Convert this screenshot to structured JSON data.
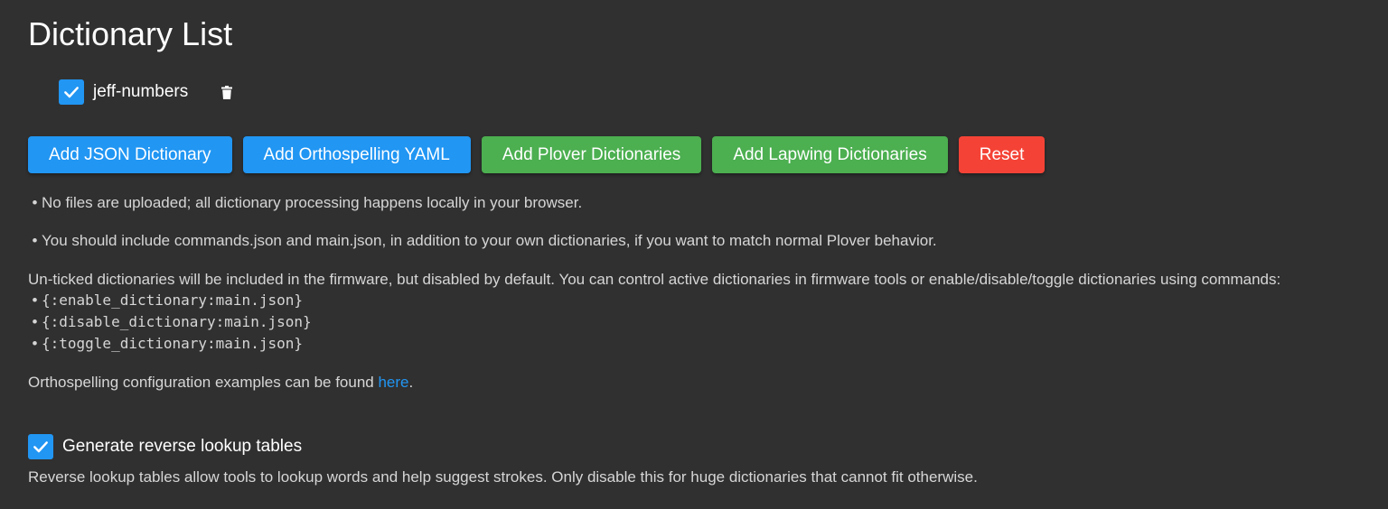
{
  "page": {
    "title": "Dictionary List"
  },
  "dictionaries": [
    {
      "name": "jeff-numbers",
      "checked": true
    }
  ],
  "buttons": {
    "add_json": "Add JSON Dictionary",
    "add_orthospelling": "Add Orthospelling YAML",
    "add_plover": "Add Plover Dictionaries",
    "add_lapwing": "Add Lapwing Dictionaries",
    "reset": "Reset"
  },
  "notes": {
    "bullet": "•",
    "no_upload": "No files are uploaded; all dictionary processing happens locally in your browser.",
    "include_commands": "You should include commands.json and main.json, in addition to your own dictionaries, if you want to match normal Plover behavior.",
    "unticked": "Un-ticked dictionaries will be included in the firmware, but disabled by default. You can control active dictionaries in firmware tools or enable/disable/toggle dictionaries using commands:",
    "commands": [
      "{:enable_dictionary:main.json}",
      "{:disable_dictionary:main.json}",
      "{:toggle_dictionary:main.json}"
    ],
    "ortho_prefix": "Orthospelling configuration examples can be found ",
    "ortho_link": "here",
    "ortho_suffix": "."
  },
  "reverse_lookup": {
    "label": "Generate reverse lookup tables",
    "checked": true,
    "description": "Reverse lookup tables allow tools to lookup words and help suggest strokes. Only disable this for huge dictionaries that cannot fit otherwise."
  },
  "colors": {
    "background": "#303030",
    "primary": "#2196f3",
    "success": "#4caf50",
    "danger": "#f44336"
  }
}
